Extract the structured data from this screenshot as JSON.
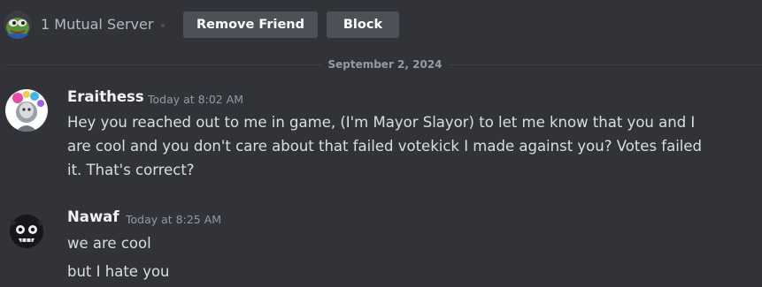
{
  "profile_bar": {
    "mutual_servers_label": "1 Mutual Server",
    "remove_friend_label": "Remove Friend",
    "block_label": "Block"
  },
  "divider": {
    "date": "September 2, 2024"
  },
  "messages": [
    {
      "author": "Eraithess",
      "timestamp": "Today at 8:02 AM",
      "lines": [
        "Hey you reached out to me in game, (I'm Mayor Slayor) to let me know that you and I are cool and you don't care about that failed votekick I made against you? Votes failed it. That's correct?"
      ]
    },
    {
      "author": "Nawaf",
      "timestamp": "Today at 8:25 AM",
      "lines": [
        "we are cool",
        "but I hate you"
      ]
    }
  ],
  "colors": {
    "background": "#313338",
    "button": "#4e5058",
    "username": "#f2f3f5",
    "text": "#dbdee1",
    "muted": "#949ba4"
  }
}
